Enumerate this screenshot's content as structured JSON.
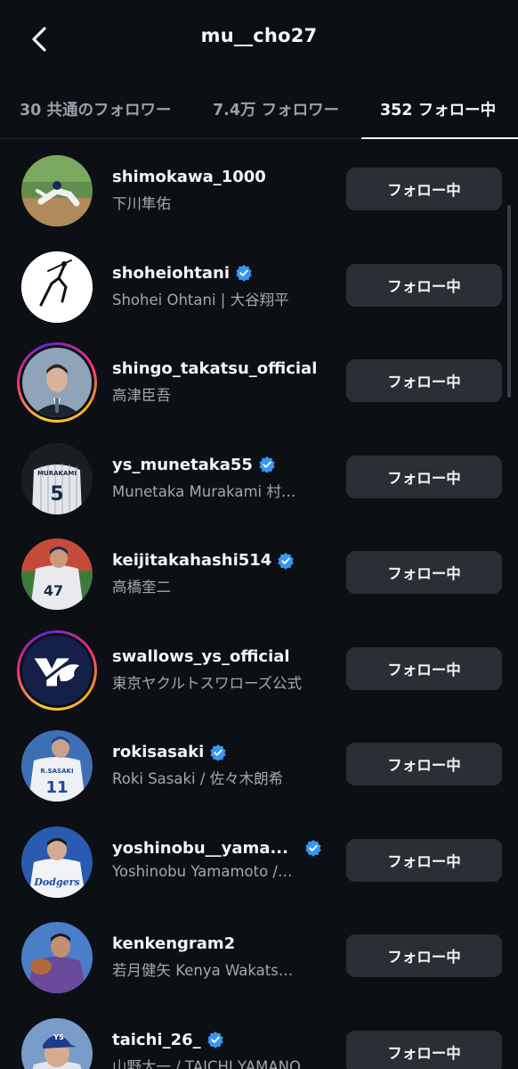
{
  "header": {
    "title": "mu__cho27",
    "back_icon": "chevron-left-icon"
  },
  "tabs": [
    {
      "label": "30 共通のフォロワー",
      "active": false
    },
    {
      "label": "7.4万 フォロワー",
      "active": false
    },
    {
      "label": "352 フォロー中",
      "active": true
    }
  ],
  "colors": {
    "background": "#0c0f14",
    "button_bg": "#2a2e35",
    "verified_blue": "#3897f0",
    "secondary_text": "#a3a8b0"
  },
  "follow_label": "フォロー中",
  "users": [
    {
      "username": "shimokawa_1000",
      "name": "下川隼佑",
      "verified": false,
      "story_ring": false
    },
    {
      "username": "shoheiohtani",
      "name": "Shohei Ohtani | 大谷翔平",
      "verified": true,
      "story_ring": false
    },
    {
      "username": "shingo_takatsu_official",
      "name": "高津臣吾",
      "verified": false,
      "story_ring": true
    },
    {
      "username": "ys_munetaka55",
      "name": "Munetaka Murakami 村…",
      "verified": true,
      "story_ring": false
    },
    {
      "username": "keijitakahashi514",
      "name": "高橋奎二",
      "verified": true,
      "story_ring": false
    },
    {
      "username": "swallows_ys_official",
      "name": "東京ヤクルトスワローズ公式",
      "verified": false,
      "story_ring": true
    },
    {
      "username": "rokisasaki",
      "name": "Roki Sasaki / 佐々木朗希",
      "verified": true,
      "story_ring": false
    },
    {
      "username": "yoshinobu__yama...",
      "name": "Yoshinobu Yamamoto /…",
      "verified": true,
      "story_ring": false
    },
    {
      "username": "kenkengram2",
      "name": "若月健矢 Kenya Wakats…",
      "verified": false,
      "story_ring": false
    },
    {
      "username": "taichi_26_",
      "name": "山野太一 / TAICHI YAMANO",
      "verified": true,
      "story_ring": false
    }
  ]
}
